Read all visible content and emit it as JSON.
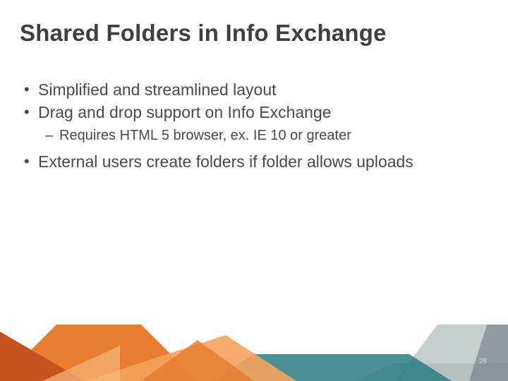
{
  "slide": {
    "title": "Shared Folders in Info Exchange",
    "bullets": [
      {
        "level": 1,
        "text": "Simplified and streamlined layout"
      },
      {
        "level": 1,
        "text": "Drag and drop support on Info Exchange"
      },
      {
        "level": 2,
        "text": "Requires HTML 5 browser, ex. IE 10 or greater"
      },
      {
        "level": 1,
        "text": "External users create folders if folder allows uploads"
      }
    ],
    "page_number": "28"
  },
  "colors": {
    "orange_dark": "#c7531e",
    "orange_mid": "#e87c2f",
    "orange_light": "#f5a35c",
    "teal": "#2a7d82",
    "grey": "#9aa7ab",
    "grey_light": "#d6dcde"
  }
}
